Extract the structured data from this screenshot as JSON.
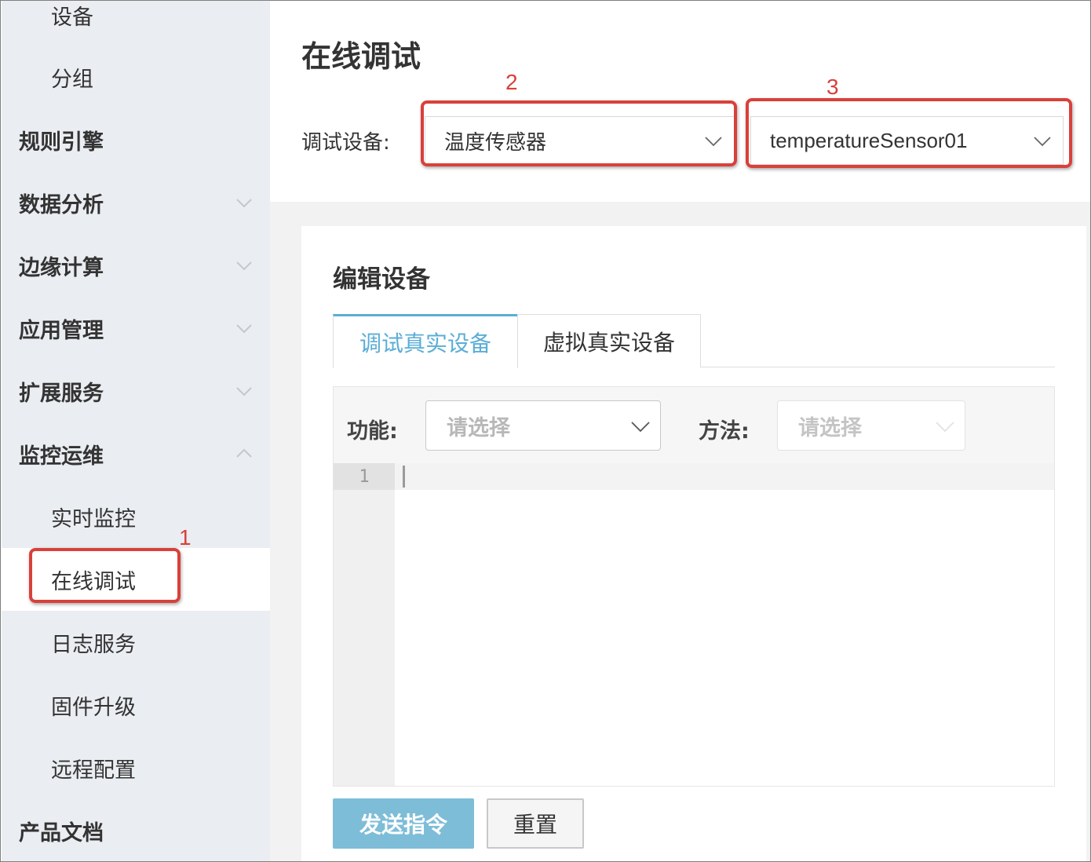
{
  "sidebar": {
    "items": [
      {
        "label": "设备",
        "level": "sub"
      },
      {
        "label": "分组",
        "level": "sub"
      },
      {
        "label": "规则引擎",
        "level": "top"
      },
      {
        "label": "数据分析",
        "level": "top",
        "expandable": true
      },
      {
        "label": "边缘计算",
        "level": "top",
        "expandable": true
      },
      {
        "label": "应用管理",
        "level": "top",
        "expandable": true
      },
      {
        "label": "扩展服务",
        "level": "top",
        "expandable": true
      },
      {
        "label": "监控运维",
        "level": "top",
        "expanded": true
      },
      {
        "label": "实时监控",
        "level": "sub"
      },
      {
        "label": "在线调试",
        "level": "sub",
        "active": true
      },
      {
        "label": "日志服务",
        "level": "sub"
      },
      {
        "label": "固件升级",
        "level": "sub"
      },
      {
        "label": "远程配置",
        "level": "sub"
      },
      {
        "label": "产品文档",
        "level": "top"
      }
    ]
  },
  "header": {
    "title": "在线调试",
    "device_label": "调试设备:",
    "product_select": "温度传感器",
    "device_select": "temperatureSensor01"
  },
  "annotations": {
    "one": "1",
    "two": "2",
    "three": "3",
    "color": "#d9403a"
  },
  "card": {
    "title": "编辑设备",
    "tabs": [
      {
        "label": "调试真实设备",
        "active": true
      },
      {
        "label": "虚拟真实设备",
        "active": false
      }
    ],
    "function_label": "功能:",
    "function_placeholder": "请选择",
    "method_label": "方法:",
    "method_placeholder": "请选择",
    "editor_line": "1",
    "send_button": "发送指令",
    "reset_button": "重置"
  },
  "colors": {
    "accent": "#5aaed6",
    "send_button": "#7ebdd8",
    "sidebar_bg": "#eaedf1"
  }
}
